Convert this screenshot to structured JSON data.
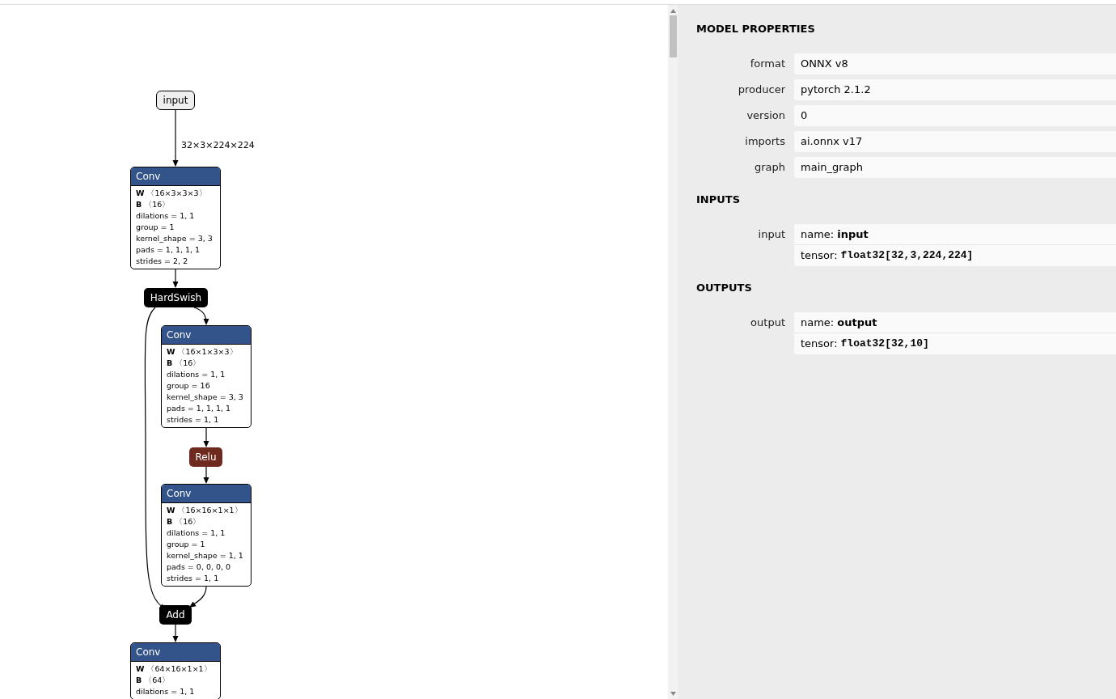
{
  "graph": {
    "nodes": [
      {
        "kind": "input",
        "label": "input",
        "output_shape": "32×3×224×224"
      },
      {
        "kind": "op",
        "label": "Conv",
        "color": "#33548a",
        "attributes": [
          {
            "kind": "tensor",
            "name": "W",
            "value": "〈16×3×3×3〉"
          },
          {
            "kind": "tensor",
            "name": "B",
            "value": "〈16〉"
          },
          {
            "kind": "attribute",
            "text": "dilations = 1, 1"
          },
          {
            "kind": "attribute",
            "text": "group = 1"
          },
          {
            "kind": "attribute",
            "text": "kernel_shape = 3, 3"
          },
          {
            "kind": "attribute",
            "text": "pads = 1, 1, 1, 1"
          },
          {
            "kind": "attribute",
            "text": "strides = 2, 2"
          }
        ]
      },
      {
        "kind": "op",
        "label": "HardSwish",
        "color": "#000000"
      },
      {
        "kind": "op",
        "label": "Conv",
        "color": "#33548a",
        "attributes": [
          {
            "kind": "tensor",
            "name": "W",
            "value": "〈16×1×3×3〉"
          },
          {
            "kind": "tensor",
            "name": "B",
            "value": "〈16〉"
          },
          {
            "kind": "attribute",
            "text": "dilations = 1, 1"
          },
          {
            "kind": "attribute",
            "text": "group = 16"
          },
          {
            "kind": "attribute",
            "text": "kernel_shape = 3, 3"
          },
          {
            "kind": "attribute",
            "text": "pads = 1, 1, 1, 1"
          },
          {
            "kind": "attribute",
            "text": "strides = 1, 1"
          }
        ]
      },
      {
        "kind": "op",
        "label": "Relu",
        "color": "#6e2a1f"
      },
      {
        "kind": "op",
        "label": "Conv",
        "color": "#33548a",
        "attributes": [
          {
            "kind": "tensor",
            "name": "W",
            "value": "〈16×16×1×1〉"
          },
          {
            "kind": "tensor",
            "name": "B",
            "value": "〈16〉"
          },
          {
            "kind": "attribute",
            "text": "dilations = 1, 1"
          },
          {
            "kind": "attribute",
            "text": "group = 1"
          },
          {
            "kind": "attribute",
            "text": "kernel_shape = 1, 1"
          },
          {
            "kind": "attribute",
            "text": "pads = 0, 0, 0, 0"
          },
          {
            "kind": "attribute",
            "text": "strides = 1, 1"
          }
        ]
      },
      {
        "kind": "op",
        "label": "Add",
        "color": "#000000"
      },
      {
        "kind": "op",
        "label": "Conv",
        "color": "#33548a",
        "attributes": [
          {
            "kind": "tensor",
            "name": "W",
            "value": "〈64×16×1×1〉"
          },
          {
            "kind": "tensor",
            "name": "B",
            "value": "〈64〉"
          },
          {
            "kind": "attribute",
            "text": "dilations = 1, 1"
          }
        ]
      }
    ]
  },
  "properties": {
    "sections": [
      {
        "title": "MODEL PROPERTIES",
        "rows": [
          {
            "label": "format",
            "values": [
              {
                "kind": "text",
                "text": "ONNX v8"
              }
            ]
          },
          {
            "label": "producer",
            "values": [
              {
                "kind": "text",
                "text": "pytorch 2.1.2"
              }
            ]
          },
          {
            "label": "version",
            "values": [
              {
                "kind": "text",
                "text": "0"
              }
            ]
          },
          {
            "label": "imports",
            "values": [
              {
                "kind": "text",
                "text": "ai.onnx v17"
              }
            ]
          },
          {
            "label": "graph",
            "values": [
              {
                "kind": "text",
                "text": "main_graph"
              }
            ]
          }
        ]
      },
      {
        "title": "INPUTS",
        "rows": [
          {
            "label": "input",
            "values": [
              {
                "kind": "name",
                "prefix": "name:",
                "text": "input"
              },
              {
                "kind": "tensor",
                "prefix": "tensor:",
                "text": "float32[32,3,224,224]"
              }
            ]
          }
        ]
      },
      {
        "title": "OUTPUTS",
        "rows": [
          {
            "label": "output",
            "values": [
              {
                "kind": "name",
                "prefix": "name:",
                "text": "output"
              },
              {
                "kind": "tensor",
                "prefix": "tensor:",
                "text": "float32[32,10]"
              }
            ]
          }
        ]
      }
    ]
  }
}
